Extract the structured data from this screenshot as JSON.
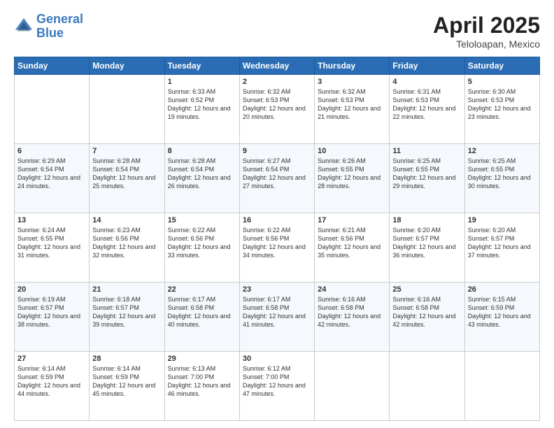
{
  "header": {
    "logo_line1": "General",
    "logo_line2": "Blue",
    "title": "April 2025",
    "subtitle": "Teloloapan, Mexico"
  },
  "days": [
    "Sunday",
    "Monday",
    "Tuesday",
    "Wednesday",
    "Thursday",
    "Friday",
    "Saturday"
  ],
  "weeks": [
    [
      {
        "num": "",
        "sunrise": "",
        "sunset": "",
        "daylight": ""
      },
      {
        "num": "",
        "sunrise": "",
        "sunset": "",
        "daylight": ""
      },
      {
        "num": "1",
        "sunrise": "Sunrise: 6:33 AM",
        "sunset": "Sunset: 6:52 PM",
        "daylight": "Daylight: 12 hours and 19 minutes."
      },
      {
        "num": "2",
        "sunrise": "Sunrise: 6:32 AM",
        "sunset": "Sunset: 6:53 PM",
        "daylight": "Daylight: 12 hours and 20 minutes."
      },
      {
        "num": "3",
        "sunrise": "Sunrise: 6:32 AM",
        "sunset": "Sunset: 6:53 PM",
        "daylight": "Daylight: 12 hours and 21 minutes."
      },
      {
        "num": "4",
        "sunrise": "Sunrise: 6:31 AM",
        "sunset": "Sunset: 6:53 PM",
        "daylight": "Daylight: 12 hours and 22 minutes."
      },
      {
        "num": "5",
        "sunrise": "Sunrise: 6:30 AM",
        "sunset": "Sunset: 6:53 PM",
        "daylight": "Daylight: 12 hours and 23 minutes."
      }
    ],
    [
      {
        "num": "6",
        "sunrise": "Sunrise: 6:29 AM",
        "sunset": "Sunset: 6:54 PM",
        "daylight": "Daylight: 12 hours and 24 minutes."
      },
      {
        "num": "7",
        "sunrise": "Sunrise: 6:28 AM",
        "sunset": "Sunset: 6:54 PM",
        "daylight": "Daylight: 12 hours and 25 minutes."
      },
      {
        "num": "8",
        "sunrise": "Sunrise: 6:28 AM",
        "sunset": "Sunset: 6:54 PM",
        "daylight": "Daylight: 12 hours and 26 minutes."
      },
      {
        "num": "9",
        "sunrise": "Sunrise: 6:27 AM",
        "sunset": "Sunset: 6:54 PM",
        "daylight": "Daylight: 12 hours and 27 minutes."
      },
      {
        "num": "10",
        "sunrise": "Sunrise: 6:26 AM",
        "sunset": "Sunset: 6:55 PM",
        "daylight": "Daylight: 12 hours and 28 minutes."
      },
      {
        "num": "11",
        "sunrise": "Sunrise: 6:25 AM",
        "sunset": "Sunset: 6:55 PM",
        "daylight": "Daylight: 12 hours and 29 minutes."
      },
      {
        "num": "12",
        "sunrise": "Sunrise: 6:25 AM",
        "sunset": "Sunset: 6:55 PM",
        "daylight": "Daylight: 12 hours and 30 minutes."
      }
    ],
    [
      {
        "num": "13",
        "sunrise": "Sunrise: 6:24 AM",
        "sunset": "Sunset: 6:55 PM",
        "daylight": "Daylight: 12 hours and 31 minutes."
      },
      {
        "num": "14",
        "sunrise": "Sunrise: 6:23 AM",
        "sunset": "Sunset: 6:56 PM",
        "daylight": "Daylight: 12 hours and 32 minutes."
      },
      {
        "num": "15",
        "sunrise": "Sunrise: 6:22 AM",
        "sunset": "Sunset: 6:56 PM",
        "daylight": "Daylight: 12 hours and 33 minutes."
      },
      {
        "num": "16",
        "sunrise": "Sunrise: 6:22 AM",
        "sunset": "Sunset: 6:56 PM",
        "daylight": "Daylight: 12 hours and 34 minutes."
      },
      {
        "num": "17",
        "sunrise": "Sunrise: 6:21 AM",
        "sunset": "Sunset: 6:56 PM",
        "daylight": "Daylight: 12 hours and 35 minutes."
      },
      {
        "num": "18",
        "sunrise": "Sunrise: 6:20 AM",
        "sunset": "Sunset: 6:57 PM",
        "daylight": "Daylight: 12 hours and 36 minutes."
      },
      {
        "num": "19",
        "sunrise": "Sunrise: 6:20 AM",
        "sunset": "Sunset: 6:57 PM",
        "daylight": "Daylight: 12 hours and 37 minutes."
      }
    ],
    [
      {
        "num": "20",
        "sunrise": "Sunrise: 6:19 AM",
        "sunset": "Sunset: 6:57 PM",
        "daylight": "Daylight: 12 hours and 38 minutes."
      },
      {
        "num": "21",
        "sunrise": "Sunrise: 6:18 AM",
        "sunset": "Sunset: 6:57 PM",
        "daylight": "Daylight: 12 hours and 39 minutes."
      },
      {
        "num": "22",
        "sunrise": "Sunrise: 6:17 AM",
        "sunset": "Sunset: 6:58 PM",
        "daylight": "Daylight: 12 hours and 40 minutes."
      },
      {
        "num": "23",
        "sunrise": "Sunrise: 6:17 AM",
        "sunset": "Sunset: 6:58 PM",
        "daylight": "Daylight: 12 hours and 41 minutes."
      },
      {
        "num": "24",
        "sunrise": "Sunrise: 6:16 AM",
        "sunset": "Sunset: 6:58 PM",
        "daylight": "Daylight: 12 hours and 42 minutes."
      },
      {
        "num": "25",
        "sunrise": "Sunrise: 6:16 AM",
        "sunset": "Sunset: 6:58 PM",
        "daylight": "Daylight: 12 hours and 42 minutes."
      },
      {
        "num": "26",
        "sunrise": "Sunrise: 6:15 AM",
        "sunset": "Sunset: 6:59 PM",
        "daylight": "Daylight: 12 hours and 43 minutes."
      }
    ],
    [
      {
        "num": "27",
        "sunrise": "Sunrise: 6:14 AM",
        "sunset": "Sunset: 6:59 PM",
        "daylight": "Daylight: 12 hours and 44 minutes."
      },
      {
        "num": "28",
        "sunrise": "Sunrise: 6:14 AM",
        "sunset": "Sunset: 6:59 PM",
        "daylight": "Daylight: 12 hours and 45 minutes."
      },
      {
        "num": "29",
        "sunrise": "Sunrise: 6:13 AM",
        "sunset": "Sunset: 7:00 PM",
        "daylight": "Daylight: 12 hours and 46 minutes."
      },
      {
        "num": "30",
        "sunrise": "Sunrise: 6:12 AM",
        "sunset": "Sunset: 7:00 PM",
        "daylight": "Daylight: 12 hours and 47 minutes."
      },
      {
        "num": "",
        "sunrise": "",
        "sunset": "",
        "daylight": ""
      },
      {
        "num": "",
        "sunrise": "",
        "sunset": "",
        "daylight": ""
      },
      {
        "num": "",
        "sunrise": "",
        "sunset": "",
        "daylight": ""
      }
    ]
  ]
}
